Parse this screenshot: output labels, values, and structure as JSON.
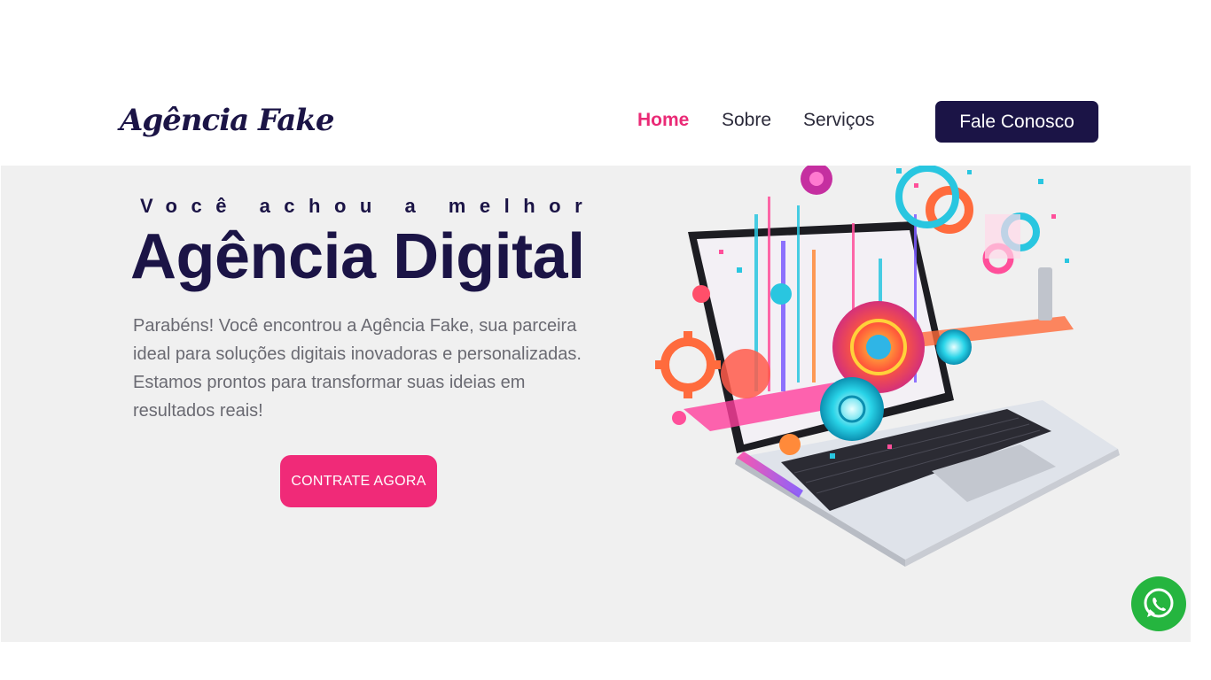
{
  "header": {
    "logo_text": "Agência Fake",
    "nav": [
      {
        "label": "Home",
        "active": true
      },
      {
        "label": "Sobre",
        "active": false
      },
      {
        "label": "Serviços",
        "active": false
      }
    ],
    "cta_label": "Fale Conosco"
  },
  "hero": {
    "kicker": "Você achou a melhor",
    "headline": "Agência Digital",
    "description": "Parabéns! Você encontrou a Agência Fake, sua parceira ideal para soluções digitais inovadoras e personalizadas. Estamos prontos para transformar suas ideias em resultados reais!",
    "button_label": "CONTRATE AGORA",
    "image_icon": "laptop-illustration"
  },
  "floating": {
    "whatsapp_icon": "whatsapp-icon"
  },
  "colors": {
    "primary": "#1b1446",
    "accent": "#f02a78",
    "hero_bg": "#f0f0f0",
    "whatsapp": "#25b53f"
  }
}
